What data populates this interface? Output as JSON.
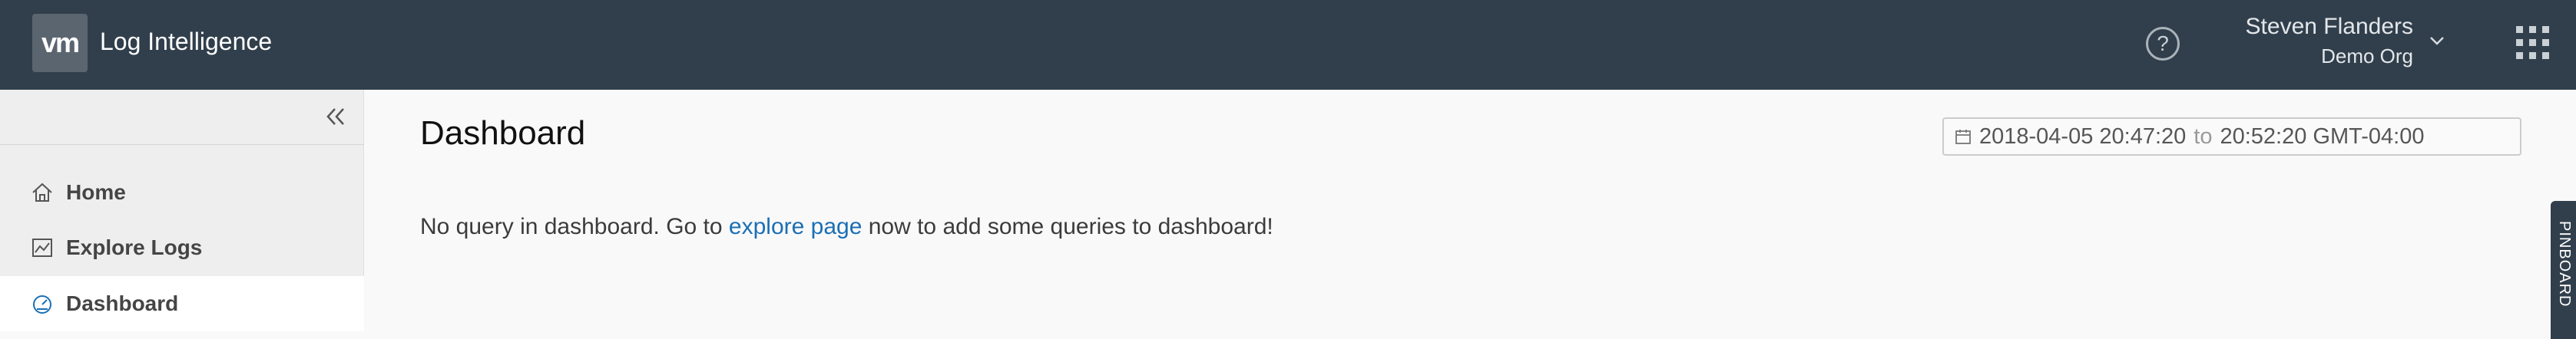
{
  "header": {
    "logo_text": "vm",
    "app_title": "Log Intelligence",
    "help_icon": "question-circle-icon",
    "user": {
      "name": "Steven Flanders",
      "org": "Demo Org"
    },
    "apps_icon": "app-grid-icon",
    "colors": {
      "background": "#313f4c",
      "text": "#ffffff"
    }
  },
  "sidebar": {
    "collapse_icon": "double-chevron-left-icon",
    "items": [
      {
        "label": "Home",
        "icon": "home-icon",
        "active": false
      },
      {
        "label": "Explore Logs",
        "icon": "line-chart-icon",
        "active": false
      },
      {
        "label": "Dashboard",
        "icon": "dashboard-gauge-icon",
        "active": true
      }
    ]
  },
  "main": {
    "title": "Dashboard",
    "date_range": {
      "icon": "calendar-icon",
      "start": "2018-04-05 20:47:20",
      "separator": "to",
      "end": "20:52:20 GMT-04:00"
    },
    "empty_message": {
      "before": "No query in dashboard. Go to ",
      "link": "explore page",
      "after": " now to add some queries to dashboard!"
    },
    "link_color": "#1b6fb5"
  },
  "pinboard": {
    "label": "PINBOARD"
  }
}
